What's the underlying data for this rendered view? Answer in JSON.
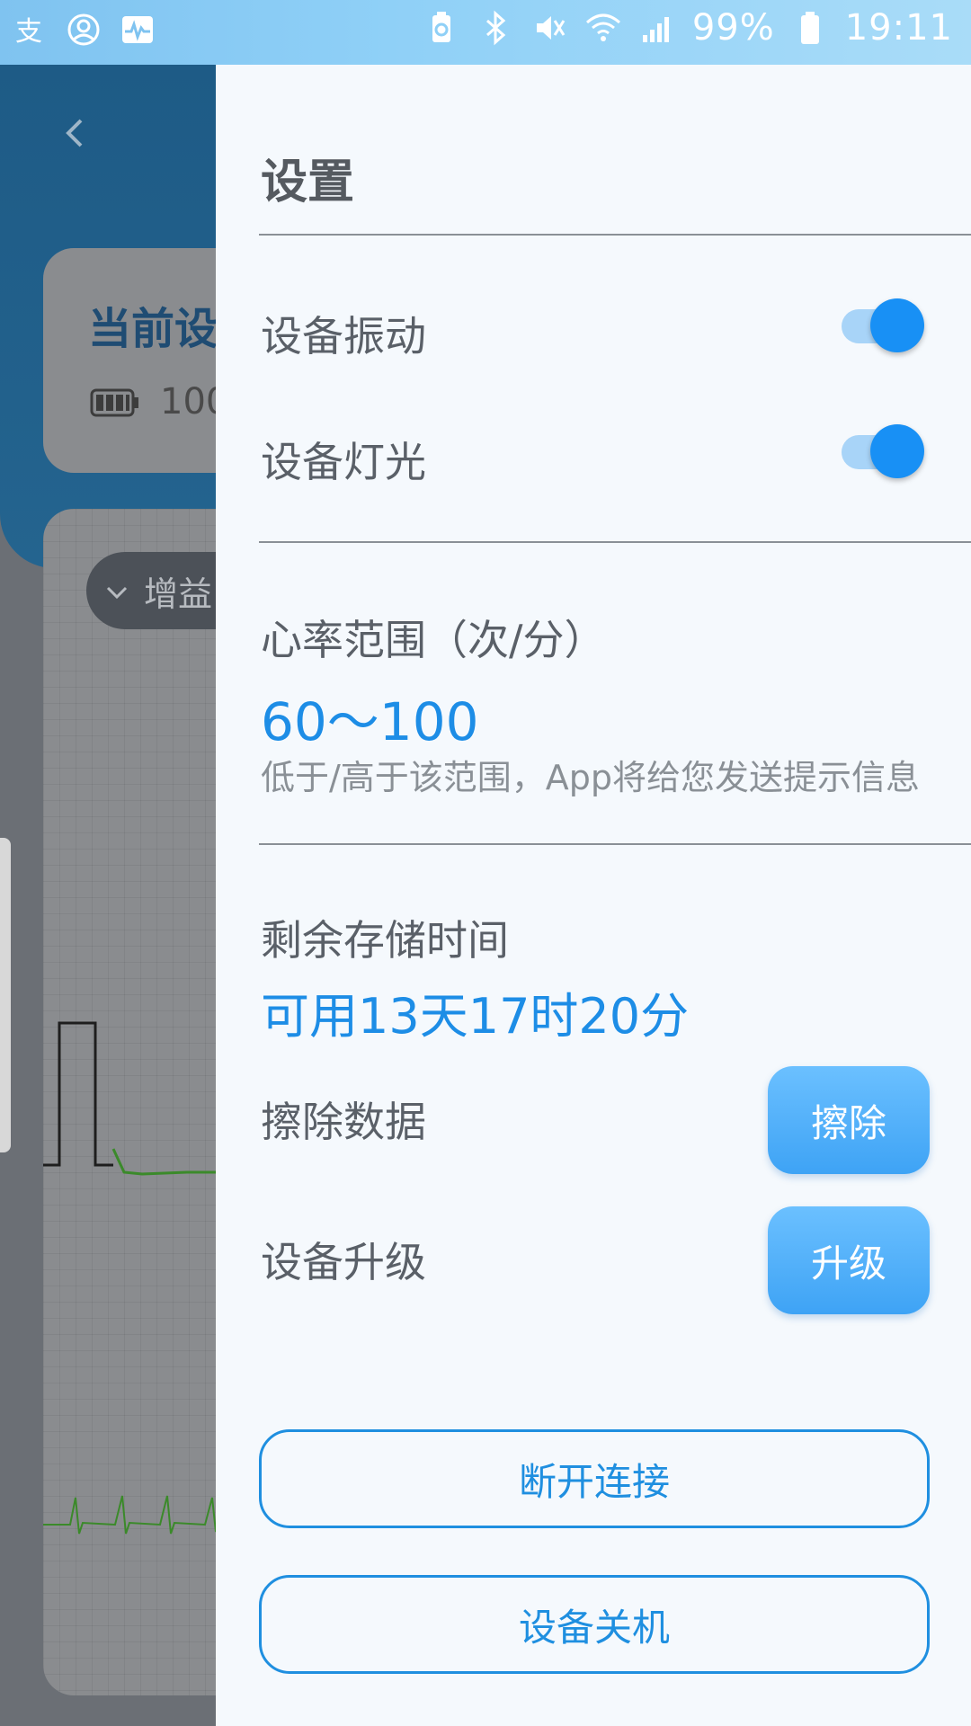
{
  "status_bar": {
    "battery": "99%",
    "time": "19:11",
    "left_icons": [
      "alipay-icon",
      "user-circle-icon",
      "pulse-icon"
    ],
    "right_icons": [
      "battery-saver-icon",
      "bluetooth-icon",
      "mute-vibrate-icon",
      "wifi-icon",
      "signal-icon",
      "battery-icon"
    ]
  },
  "background": {
    "card_title": "当前设",
    "battery_value": "100",
    "gain_label": "增益"
  },
  "drawer": {
    "title": "设置",
    "vibration": {
      "label": "设备振动",
      "on": true
    },
    "light": {
      "label": "设备灯光",
      "on": true
    },
    "heart_rate": {
      "label": "心率范围（次/分）",
      "value": "60～100",
      "hint": "低于/高于该范围，App将给您发送提示信息"
    },
    "storage": {
      "label": "剩余存储时间",
      "value": "可用13天17时20分"
    },
    "erase": {
      "label": "擦除数据",
      "button": "擦除"
    },
    "upgrade": {
      "label": "设备升级",
      "button": "升级"
    },
    "disconnect_button": "断开连接",
    "shutdown_button": "设备关机"
  },
  "colors": {
    "accent": "#1d8de6",
    "toggle_on": "#1890f5",
    "drawer_bg": "#f5f9fd"
  }
}
